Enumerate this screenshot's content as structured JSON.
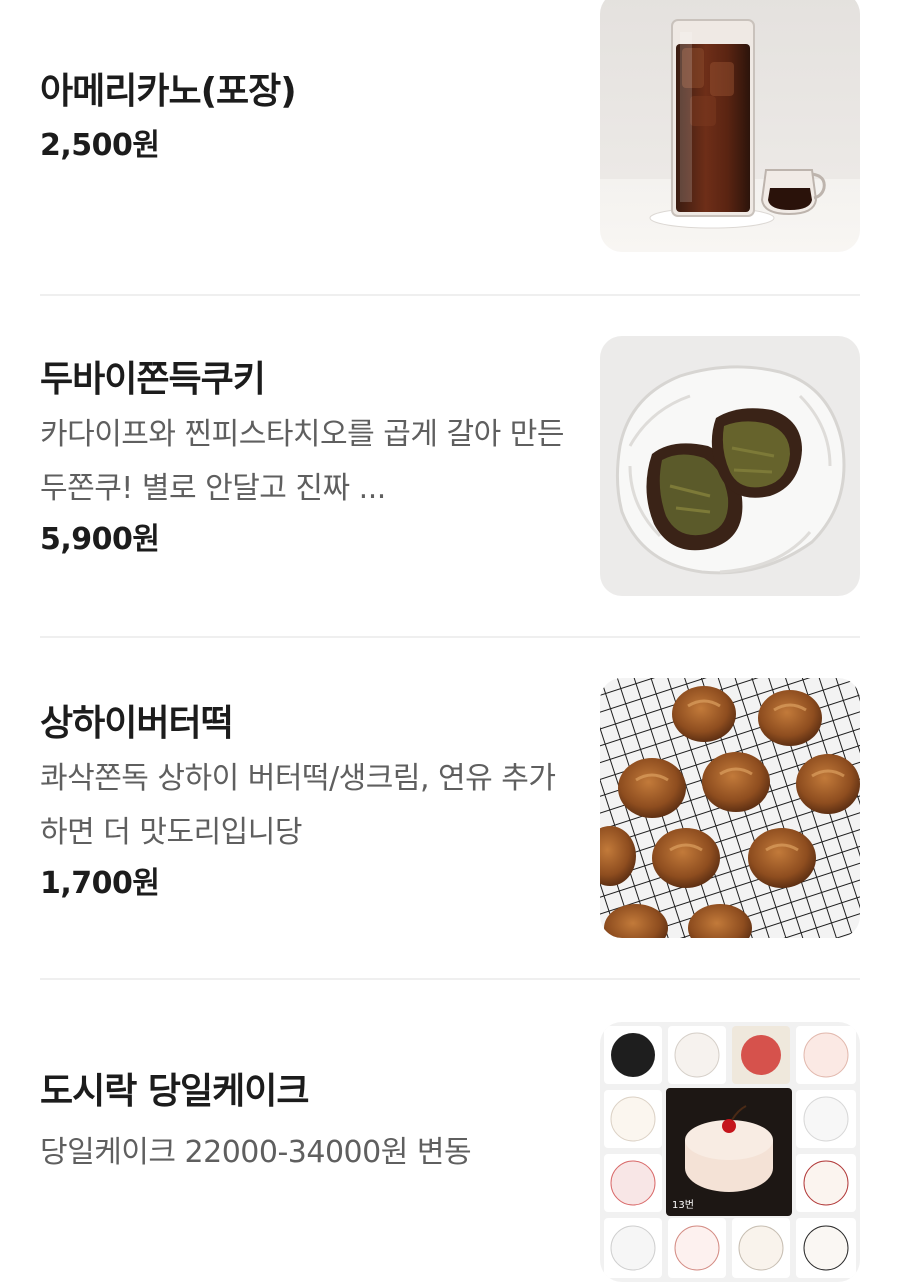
{
  "menu": {
    "items": [
      {
        "name": "아메리카노(포장)",
        "description": "",
        "price": "2,500원",
        "photo_icon": "iced-americano-photo"
      },
      {
        "name": "두바이쫀득쿠키",
        "description": "카다이프와 찐피스타치오를 곱게 갈아 만든 두쫀쿠! 별로 안달고 진짜 ...",
        "price": "5,900원",
        "photo_icon": "dubai-cookie-photo"
      },
      {
        "name": "상하이버터떡",
        "description": "콰삭쫀독 상하이 버터떡/생크림, 연유 추가하면 더 맛도리입니당",
        "price": "1,700원",
        "photo_icon": "butter-rice-cake-photo"
      },
      {
        "name": "도시락 당일케이크",
        "description": "당일케이크 22000-34000원 변동",
        "price": "",
        "photo_icon": "lunchbox-cake-photo",
        "photo_badge": "13번"
      }
    ]
  }
}
